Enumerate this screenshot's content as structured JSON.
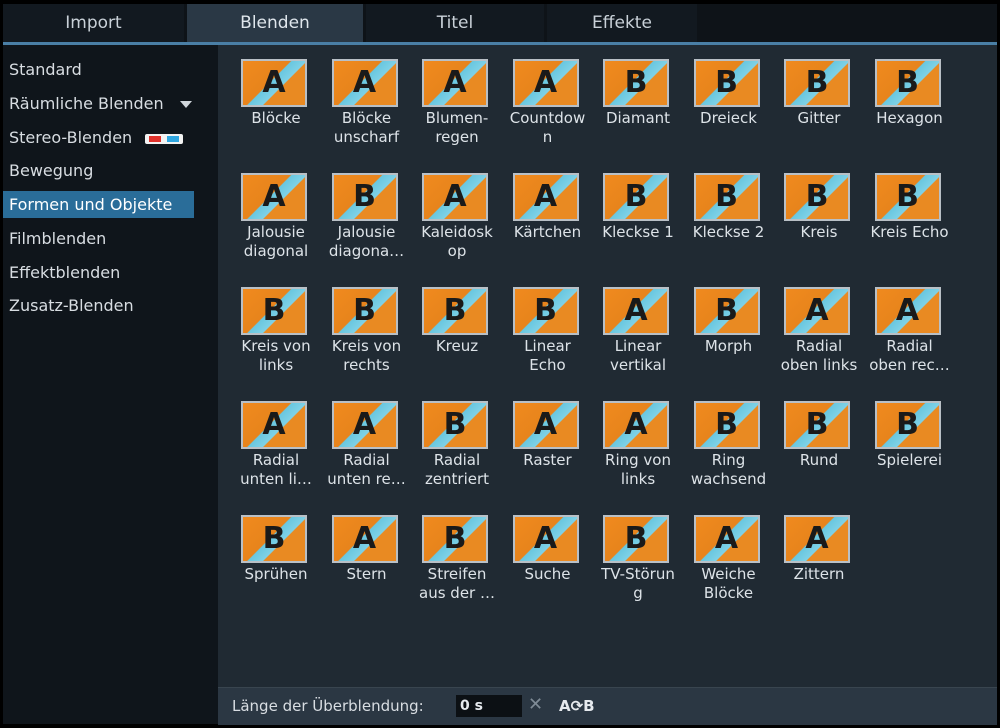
{
  "tabs": [
    {
      "label": "Import",
      "active": false
    },
    {
      "label": "Blenden",
      "active": true
    },
    {
      "label": "Titel",
      "active": false
    },
    {
      "label": "Effekte",
      "active": false
    }
  ],
  "categories": [
    {
      "label": "Standard"
    },
    {
      "label": "Räumliche Blenden",
      "icon": "chevron-down-icon"
    },
    {
      "label": "Stereo-Blenden",
      "icon": "3d-glasses-icon"
    },
    {
      "label": "Bewegung"
    },
    {
      "label": "Formen und Objekte",
      "selected": true
    },
    {
      "label": "Filmblenden"
    },
    {
      "label": "Effektblenden"
    },
    {
      "label": "Zusatz-Blenden"
    }
  ],
  "transitions": [
    {
      "label": "Blöcke",
      "glyph": "A"
    },
    {
      "label": "Blöcke\nunscharf",
      "glyph": "A"
    },
    {
      "label": "Blumen-\nregen",
      "glyph": "A"
    },
    {
      "label": "Countdow\nn",
      "glyph": "A"
    },
    {
      "label": "Diamant",
      "glyph": "B"
    },
    {
      "label": "Dreieck",
      "glyph": "B"
    },
    {
      "label": "Gitter",
      "glyph": "B"
    },
    {
      "label": "Hexagon",
      "glyph": "B"
    },
    {
      "label": "Jalousie\ndiagonal",
      "glyph": "A"
    },
    {
      "label": "Jalousie\ndiagona…",
      "glyph": "B"
    },
    {
      "label": "Kaleidosk\nop",
      "glyph": "A"
    },
    {
      "label": "Kärtchen",
      "glyph": "A"
    },
    {
      "label": "Kleckse 1",
      "glyph": "B"
    },
    {
      "label": "Kleckse 2",
      "glyph": "B"
    },
    {
      "label": "Kreis",
      "glyph": "B"
    },
    {
      "label": "Kreis Echo",
      "glyph": "B"
    },
    {
      "label": "Kreis von\nlinks",
      "glyph": "B"
    },
    {
      "label": "Kreis von\nrechts",
      "glyph": "B"
    },
    {
      "label": "Kreuz",
      "glyph": "B"
    },
    {
      "label": "Linear\nEcho",
      "glyph": "B"
    },
    {
      "label": "Linear\nvertikal",
      "glyph": "A"
    },
    {
      "label": "Morph",
      "glyph": "B"
    },
    {
      "label": "Radial\noben links",
      "glyph": "A"
    },
    {
      "label": "Radial\noben rec…",
      "glyph": "A"
    },
    {
      "label": "Radial\nunten li…",
      "glyph": "A"
    },
    {
      "label": "Radial\nunten re…",
      "glyph": "A"
    },
    {
      "label": "Radial\nzentriert",
      "glyph": "B"
    },
    {
      "label": "Raster",
      "glyph": "A"
    },
    {
      "label": "Ring von\nlinks",
      "glyph": "A"
    },
    {
      "label": "Ring\nwachsend",
      "glyph": "B"
    },
    {
      "label": "Rund",
      "glyph": "B"
    },
    {
      "label": "Spielerei",
      "glyph": "B"
    },
    {
      "label": "Sprühen",
      "glyph": "B"
    },
    {
      "label": "Stern",
      "glyph": "A"
    },
    {
      "label": "Streifen\naus der …",
      "glyph": "B"
    },
    {
      "label": "Suche",
      "glyph": "A"
    },
    {
      "label": "TV-Störun\ng",
      "glyph": "B"
    },
    {
      "label": "Weiche\nBlöcke",
      "glyph": "A"
    },
    {
      "label": "Zittern",
      "glyph": "A"
    }
  ],
  "footer": {
    "duration_label": "Länge der Überblendung:",
    "duration_value": "0 s",
    "clear_icon": "close-icon",
    "ab_label": "A⟳B"
  },
  "colors": {
    "accent": "#2a6d99",
    "thumb_orange": "#f08a1e",
    "thumb_blue": "#7fd1e6"
  }
}
